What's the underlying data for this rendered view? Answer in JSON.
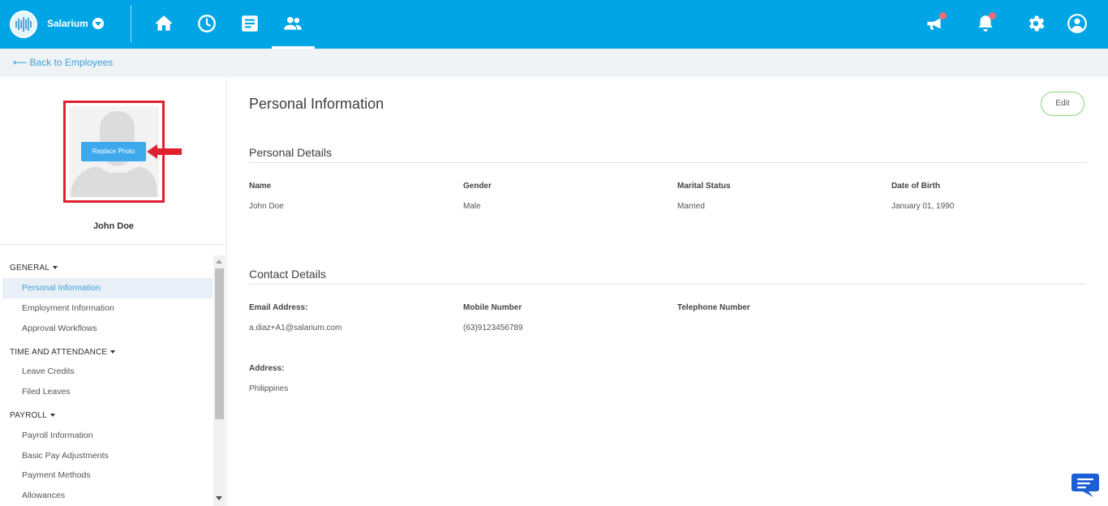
{
  "header": {
    "brand": "Salarium",
    "nav": [
      "home-icon",
      "clock-icon",
      "document-icon",
      "people-icon"
    ],
    "right": [
      "megaphone-icon",
      "bell-icon",
      "gear-icon",
      "user-icon"
    ],
    "accent": "#00a5e5",
    "notification_color": "#f16c7b"
  },
  "breadcrumb": {
    "back_label": "⟵ Back to Employees"
  },
  "profile": {
    "replace_photo_label": "Replace Photo",
    "employee_name": "John Doe"
  },
  "sidebar": {
    "groups": [
      {
        "label": "GENERAL",
        "items": [
          "Personal Information",
          "Employment Information",
          "Approval Workflows"
        ]
      },
      {
        "label": "TIME AND ATTENDANCE",
        "items": [
          "Leave Credits",
          "Filed Leaves"
        ]
      },
      {
        "label": "PAYROLL",
        "items": [
          "Payroll Information",
          "Basic Pay Adjustments",
          "Payment Methods",
          "Allowances"
        ]
      }
    ],
    "active_item": "Personal Information"
  },
  "main": {
    "title": "Personal Information",
    "edit_label": "Edit",
    "personal_details": {
      "title": "Personal Details",
      "fields": [
        {
          "label": "Name",
          "value": "John Doe"
        },
        {
          "label": "Gender",
          "value": "Male"
        },
        {
          "label": "Marital Status",
          "value": "Married"
        },
        {
          "label": "Date of Birth",
          "value": "January 01, 1990"
        }
      ]
    },
    "contact_details": {
      "title": "Contact Details",
      "fields": [
        {
          "label": "Email Address:",
          "value": "a.diaz+A1@salarium.com"
        },
        {
          "label": "Mobile Number",
          "value": "(63)9123456789"
        },
        {
          "label": "Telephone Number",
          "value": ""
        }
      ],
      "address_label": "Address:",
      "address_value": "Philippines"
    }
  }
}
